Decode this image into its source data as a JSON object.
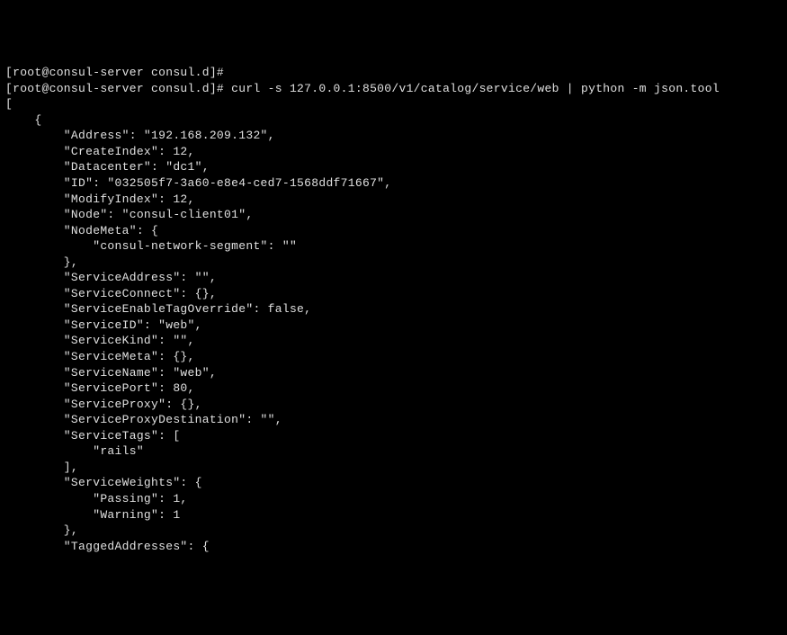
{
  "terminal": {
    "line0": "[root@consul-server consul.d]#",
    "prompt": "[root@consul-server consul.d]# ",
    "command": "curl -s 127.0.0.1:8500/v1/catalog/service/web | python -m json.tool",
    "output": {
      "l1": "[",
      "l2": "    {",
      "l3": "        \"Address\": \"192.168.209.132\",",
      "l4": "        \"CreateIndex\": 12,",
      "l5": "        \"Datacenter\": \"dc1\",",
      "l6": "        \"ID\": \"032505f7-3a60-e8e4-ced7-1568ddf71667\",",
      "l7": "        \"ModifyIndex\": 12,",
      "l8": "        \"Node\": \"consul-client01\",",
      "l9": "        \"NodeMeta\": {",
      "l10": "            \"consul-network-segment\": \"\"",
      "l11": "        },",
      "l12": "        \"ServiceAddress\": \"\",",
      "l13": "        \"ServiceConnect\": {},",
      "l14": "        \"ServiceEnableTagOverride\": false,",
      "l15": "        \"ServiceID\": \"web\",",
      "l16": "        \"ServiceKind\": \"\",",
      "l17": "        \"ServiceMeta\": {},",
      "l18": "        \"ServiceName\": \"web\",",
      "l19": "        \"ServicePort\": 80,",
      "l20": "        \"ServiceProxy\": {},",
      "l21": "        \"ServiceProxyDestination\": \"\",",
      "l22": "        \"ServiceTags\": [",
      "l23": "            \"rails\"",
      "l24": "        ],",
      "l25": "        \"ServiceWeights\": {",
      "l26": "            \"Passing\": 1,",
      "l27": "            \"Warning\": 1",
      "l28": "        },",
      "l29": "        \"TaggedAddresses\": {"
    }
  }
}
